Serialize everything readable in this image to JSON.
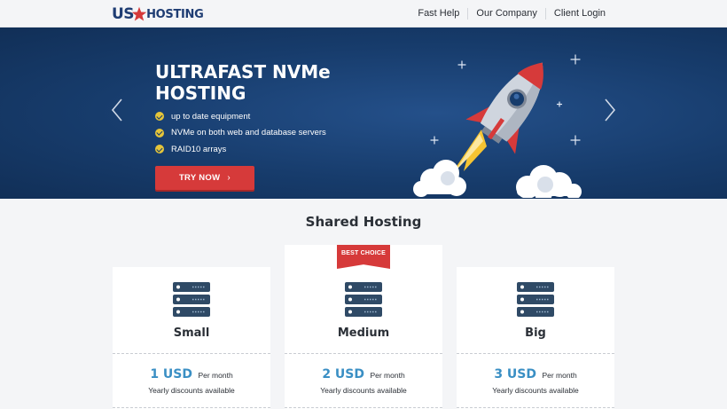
{
  "header": {
    "logo_us": "US",
    "logo_hosting": "HOSTING",
    "nav": [
      {
        "label": "Fast Help"
      },
      {
        "label": "Our Company"
      },
      {
        "label": "Client Login"
      }
    ]
  },
  "hero": {
    "title": "ULTRAFAST NVMe HOSTING",
    "features": [
      "up to date equipment",
      "NVMe on both web and database servers",
      "RAID10 arrays"
    ],
    "cta_label": "TRY NOW",
    "cta_icon": "chevron-right-icon",
    "prev_icon": "chevron-left-icon",
    "next_icon": "chevron-right-icon"
  },
  "section": {
    "title": "Shared Hosting"
  },
  "plans": [
    {
      "name": "Small",
      "price": "1 USD",
      "period": "Per month",
      "discount": "Yearly discounts available",
      "icon": "server-icon"
    },
    {
      "name": "Medium",
      "price": "2 USD",
      "period": "Per month",
      "discount": "Yearly discounts available",
      "icon": "server-icon",
      "badge": "BEST CHOICE"
    },
    {
      "name": "Big",
      "price": "3 USD",
      "period": "Per month",
      "discount": "Yearly discounts available",
      "icon": "server-icon"
    }
  ],
  "colors": {
    "brand_navy": "#1f3d73",
    "accent_red": "#d63a3a",
    "price_blue": "#3a8fc4",
    "check_yellow": "#e5c53a",
    "hero_bg": "#173c6c"
  }
}
